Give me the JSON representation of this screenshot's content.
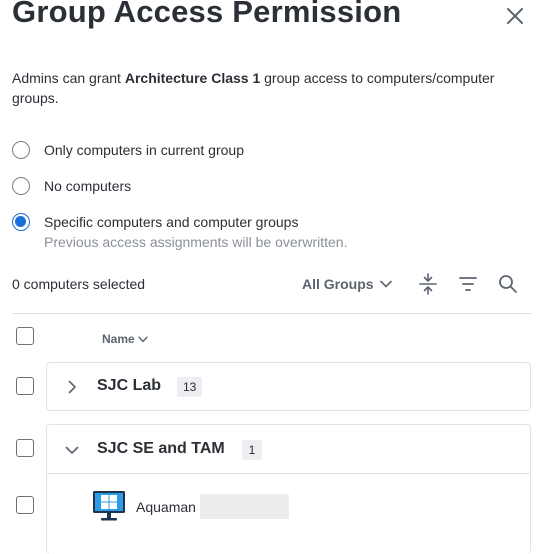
{
  "dialog": {
    "title": "Group Access Permission",
    "description_prefix": "Admins can grant ",
    "description_bold": "Architecture Class 1",
    "description_suffix": " group access to computers/computer groups."
  },
  "options": [
    {
      "label": "Only computers in current group",
      "checked": false
    },
    {
      "label": "No computers",
      "checked": false
    },
    {
      "label": "Specific computers and computer groups",
      "sublabel": "Previous access assignments will be overwritten.",
      "checked": true
    }
  ],
  "toolbar": {
    "selected_count": "0 computers selected",
    "groups_filter": "All Groups"
  },
  "table": {
    "column_name": "Name"
  },
  "groups": [
    {
      "name": "SJC Lab",
      "count": "13",
      "expanded": false
    },
    {
      "name": "SJC SE and TAM",
      "count": "1",
      "expanded": true
    }
  ],
  "computers": [
    {
      "name": "Aquaman",
      "icon": "windows-monitor-icon"
    }
  ],
  "colors": {
    "accent": "#1a6fd6",
    "text": "#2b2f36",
    "muted": "#8a9099",
    "border": "#dfe2e6"
  }
}
